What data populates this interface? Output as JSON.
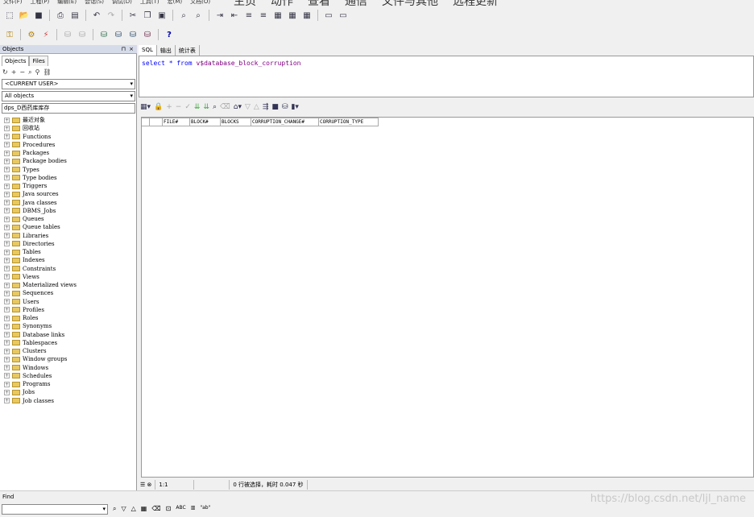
{
  "menu": [
    "文件(F)",
    "工程(P)",
    "编辑(E)",
    "会话(S)",
    "调试(D)",
    "工具(T)",
    "宏(M)",
    "文档(O)"
  ],
  "overlay": [
    "主页",
    "动作",
    "查看",
    "通信",
    "文件与其他",
    "远程更新"
  ],
  "left": {
    "header": "Objects",
    "tabs": [
      "Objects",
      "Files"
    ],
    "user_combo": "<CURRENT USER>",
    "objects_combo": "All objects",
    "filter": "dps_D西药库库存",
    "tree": [
      "最近对象",
      "回收站",
      "Functions",
      "Procedures",
      "Packages",
      "Package bodies",
      "Types",
      "Type bodies",
      "Triggers",
      "Java sources",
      "Java classes",
      "DBMS_Jobs",
      "Queues",
      "Queue tables",
      "Libraries",
      "Directories",
      "Tables",
      "Indexes",
      "Constraints",
      "Views",
      "Materialized views",
      "Sequences",
      "Users",
      "Profiles",
      "Roles",
      "Synonyms",
      "Database links",
      "Tablespaces",
      "Clusters",
      "Window groups",
      "Windows",
      "Schedules",
      "Programs",
      "Jobs",
      "Job classes"
    ]
  },
  "sql": {
    "tabs": [
      "SQL",
      "输出",
      "统计表"
    ],
    "query_kw1": "select * from ",
    "query_id": "v$database_block_corruption",
    "columns": [
      "FILE#",
      "BLOCK#",
      "BLOCKS",
      "CORRUPTION_CHANGE#",
      "CORRUPTION_TYPE"
    ]
  },
  "status": {
    "position": "1:1",
    "message": "0 行被选择，耗时 0.047 秒"
  },
  "find": {
    "label": "Find",
    "value": ""
  },
  "watermark": "https://blog.csdn.net/ljl_name"
}
